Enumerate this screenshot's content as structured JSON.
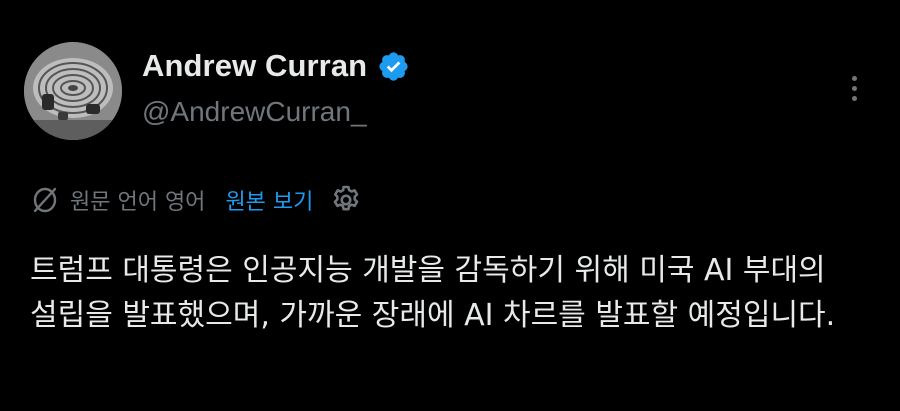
{
  "post": {
    "author": {
      "display_name": "Andrew Curran",
      "handle": "@AndrewCurran_",
      "verified": true,
      "verified_icon": "verified-badge-icon",
      "avatar": "avatar-image"
    },
    "more_icon": "more-options-icon",
    "translation": {
      "icon": "no-translate-icon",
      "label": "원문 언어 영어",
      "view_original_label": "원본 보기",
      "settings_icon": "gear-icon"
    },
    "text": "트럼프 대통령은 인공지능 개발을 감독하기 위해 미국 AI 부대의 설립을 발표했으며, 가까운 장래에 AI 차르를 발표할 예정입니다."
  },
  "colors": {
    "background": "#000000",
    "primary_text": "#e7e9ea",
    "secondary_text": "#71767b",
    "accent": "#1d9bf0"
  }
}
